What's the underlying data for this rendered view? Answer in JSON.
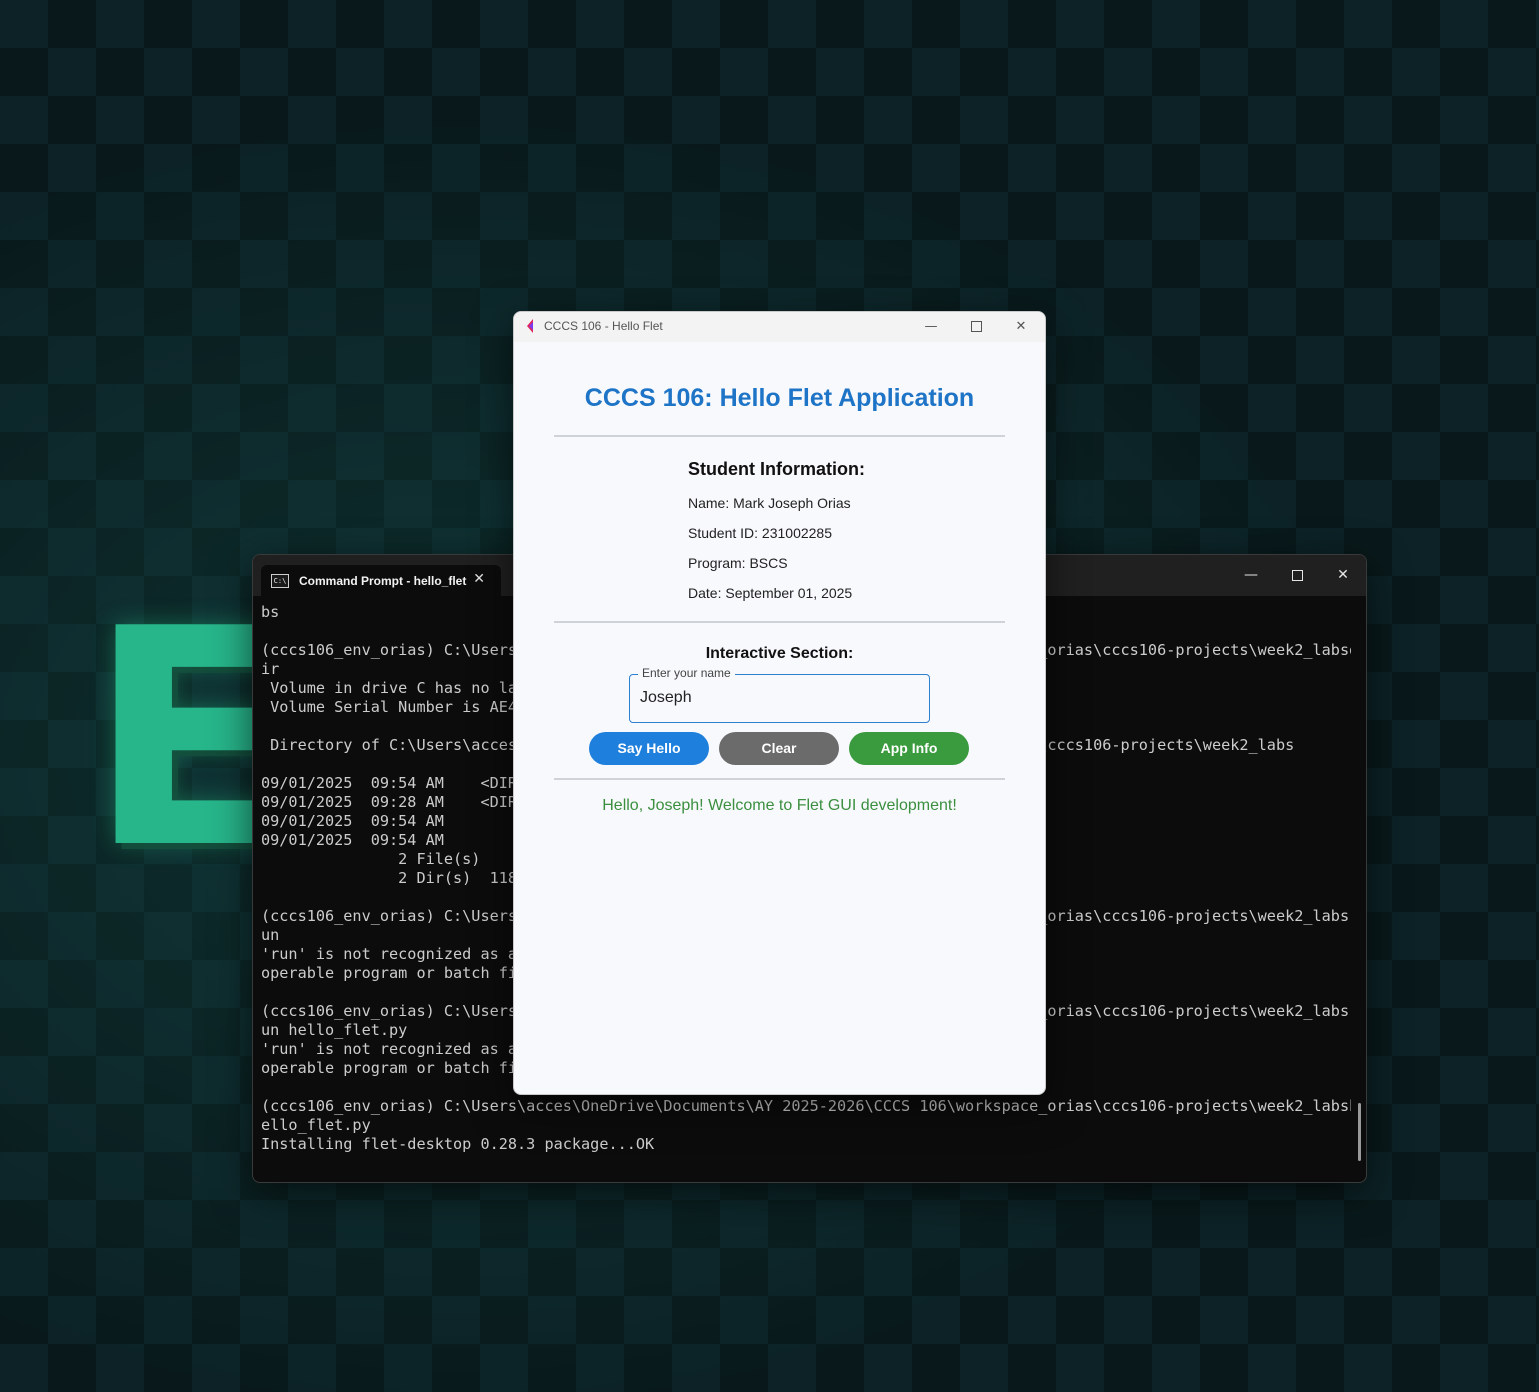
{
  "desktop": {
    "wallpaper_letters": [
      "E"
    ],
    "colors": {
      "background": "#0c2226",
      "letters": "#27b58a"
    }
  },
  "terminal": {
    "tab_title": "Command Prompt - hello_flet",
    "tab_close": "✕",
    "controls": {
      "minimize": "—",
      "close": "✕"
    },
    "lines": [
      "bs",
      "",
      "(cccs106_env_orias) C:\\Users\\acces\\OneDrive\\Documents\\AY 2025-2026\\CCCS 106\\workspace_orias\\cccs106-projects\\week2_labsd",
      "ir",
      " Volume in drive C has no label.",
      " Volume Serial Number is AE4",
      "",
      " Directory of C:\\Users\\acces\\OneDrive\\Documents\\AY 2025-2026\\CCCS 106\\workspace_orias\\cccs106-projects\\week2_labs",
      "",
      "09/01/2025  09:54 AM    <DIR>",
      "09/01/2025  09:28 AM    <DIR>",
      "09/01/2025  09:54 AM",
      "09/01/2025  09:54 AM",
      "               2 File(s)",
      "               2 Dir(s)  118",
      "",
      "(cccs106_env_orias) C:\\Users\\acces\\OneDrive\\Documents\\AY 2025-2026\\CCCS 106\\workspace_orias\\cccs106-projects\\week2_labsr",
      "un",
      "'run' is not recognized as an internal or external command,",
      "operable program or batch file.",
      "",
      "(cccs106_env_orias) C:\\Users\\acces\\OneDrive\\Documents\\AY 2025-2026\\CCCS 106\\workspace_orias\\cccs106-projects\\week2_labsr",
      "un hello_flet.py",
      "'run' is not recognized as an internal or external command,",
      "operable program or batch file.",
      "",
      "(cccs106_env_orias) C:\\Users\\acces\\OneDrive\\Documents\\AY 2025-2026\\CCCS 106\\workspace_orias\\cccs106-projects\\week2_labsh",
      "ello_flet.py",
      "Installing flet-desktop 0.28.3 package...OK"
    ]
  },
  "app": {
    "window_title": "CCCS 106 - Hello Flet",
    "controls": {
      "minimize": "—",
      "close": "✕"
    },
    "heading": "CCCS 106: Hello Flet Application",
    "student_info": {
      "heading": "Student Information:",
      "name": "Name: Mark Joseph Orias",
      "student_id": "Student ID: 231002285",
      "program": "Program: BSCS",
      "date": "Date: September 01, 2025"
    },
    "interactive": {
      "heading": "Interactive Section:",
      "name_field": {
        "label": "Enter your name",
        "value": "Joseph"
      },
      "buttons": {
        "say_hello": "Say Hello",
        "clear": "Clear",
        "app_info": "App Info"
      },
      "greeting": "Hello, Joseph! Welcome to Flet GUI development!"
    },
    "colors": {
      "heading": "#1e74c6",
      "say_hello": "#1e7fdc",
      "clear": "#6b6b6b",
      "app_info": "#3a9a3e",
      "greeting": "#3b8f3f"
    }
  }
}
